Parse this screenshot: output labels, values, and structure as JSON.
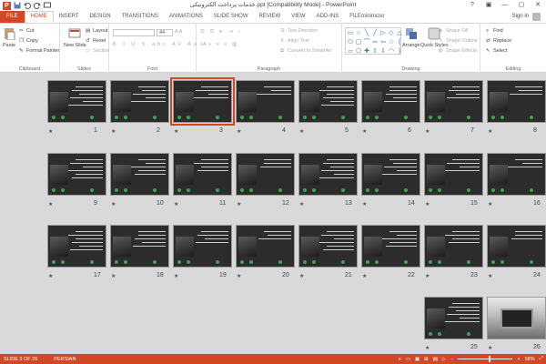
{
  "window": {
    "title": "خدمات پرداخت الکترونیکی.ppt [Compatibility Mode] - PowerPoint",
    "controls": [
      "?",
      "▣",
      "—",
      "▢",
      "✕"
    ]
  },
  "tabs": [
    "FILE",
    "HOME",
    "INSERT",
    "DESIGN",
    "TRANSITIONS",
    "ANIMATIONS",
    "SLIDE SHOW",
    "REVIEW",
    "VIEW",
    "ADD-INS",
    "FILEminimizer"
  ],
  "active_tab": "HOME",
  "account": {
    "label": "Sign in"
  },
  "ribbon": {
    "clipboard": {
      "label": "Clipboard",
      "paste": "Paste",
      "cut": "Cut",
      "copy": "Copy",
      "format_painter": "Format Painter"
    },
    "slides": {
      "label": "Slides",
      "new_slide": "New Slide",
      "layout": "Layout",
      "reset": "Reset",
      "section": "Section"
    },
    "font": {
      "label": "Font",
      "size": "44"
    },
    "paragraph": {
      "label": "Paragraph",
      "text_direction": "Text Direction",
      "align_text": "Align Text",
      "convert": "Convert to SmartArt"
    },
    "drawing": {
      "label": "Drawing",
      "arrange": "Arrange",
      "quick_styles": "Quick Styles",
      "shape_fill": "Shape Fill",
      "shape_outline": "Shape Outline",
      "shape_effects": "Shape Effects"
    },
    "editing": {
      "label": "Editing",
      "find": "Find",
      "replace": "Replace",
      "select": "Select"
    }
  },
  "sorter": {
    "selected_slide": "3",
    "rows": [
      [
        "8",
        "7",
        "6",
        "5",
        "4",
        "3",
        "2",
        "1"
      ],
      [
        "16",
        "15",
        "14",
        "13",
        "12",
        "11",
        "10",
        "9"
      ],
      [
        "24",
        "23",
        "22",
        "21",
        "20",
        "19",
        "18",
        "17"
      ],
      [
        "26",
        "25"
      ]
    ]
  },
  "status": {
    "slide_indicator": "SLIDE 3 OF 26",
    "language": "PERSIAN",
    "zoom": "58%"
  },
  "colors": {
    "accent": "#d24726",
    "sorter_bg": "#d9d9d9"
  }
}
